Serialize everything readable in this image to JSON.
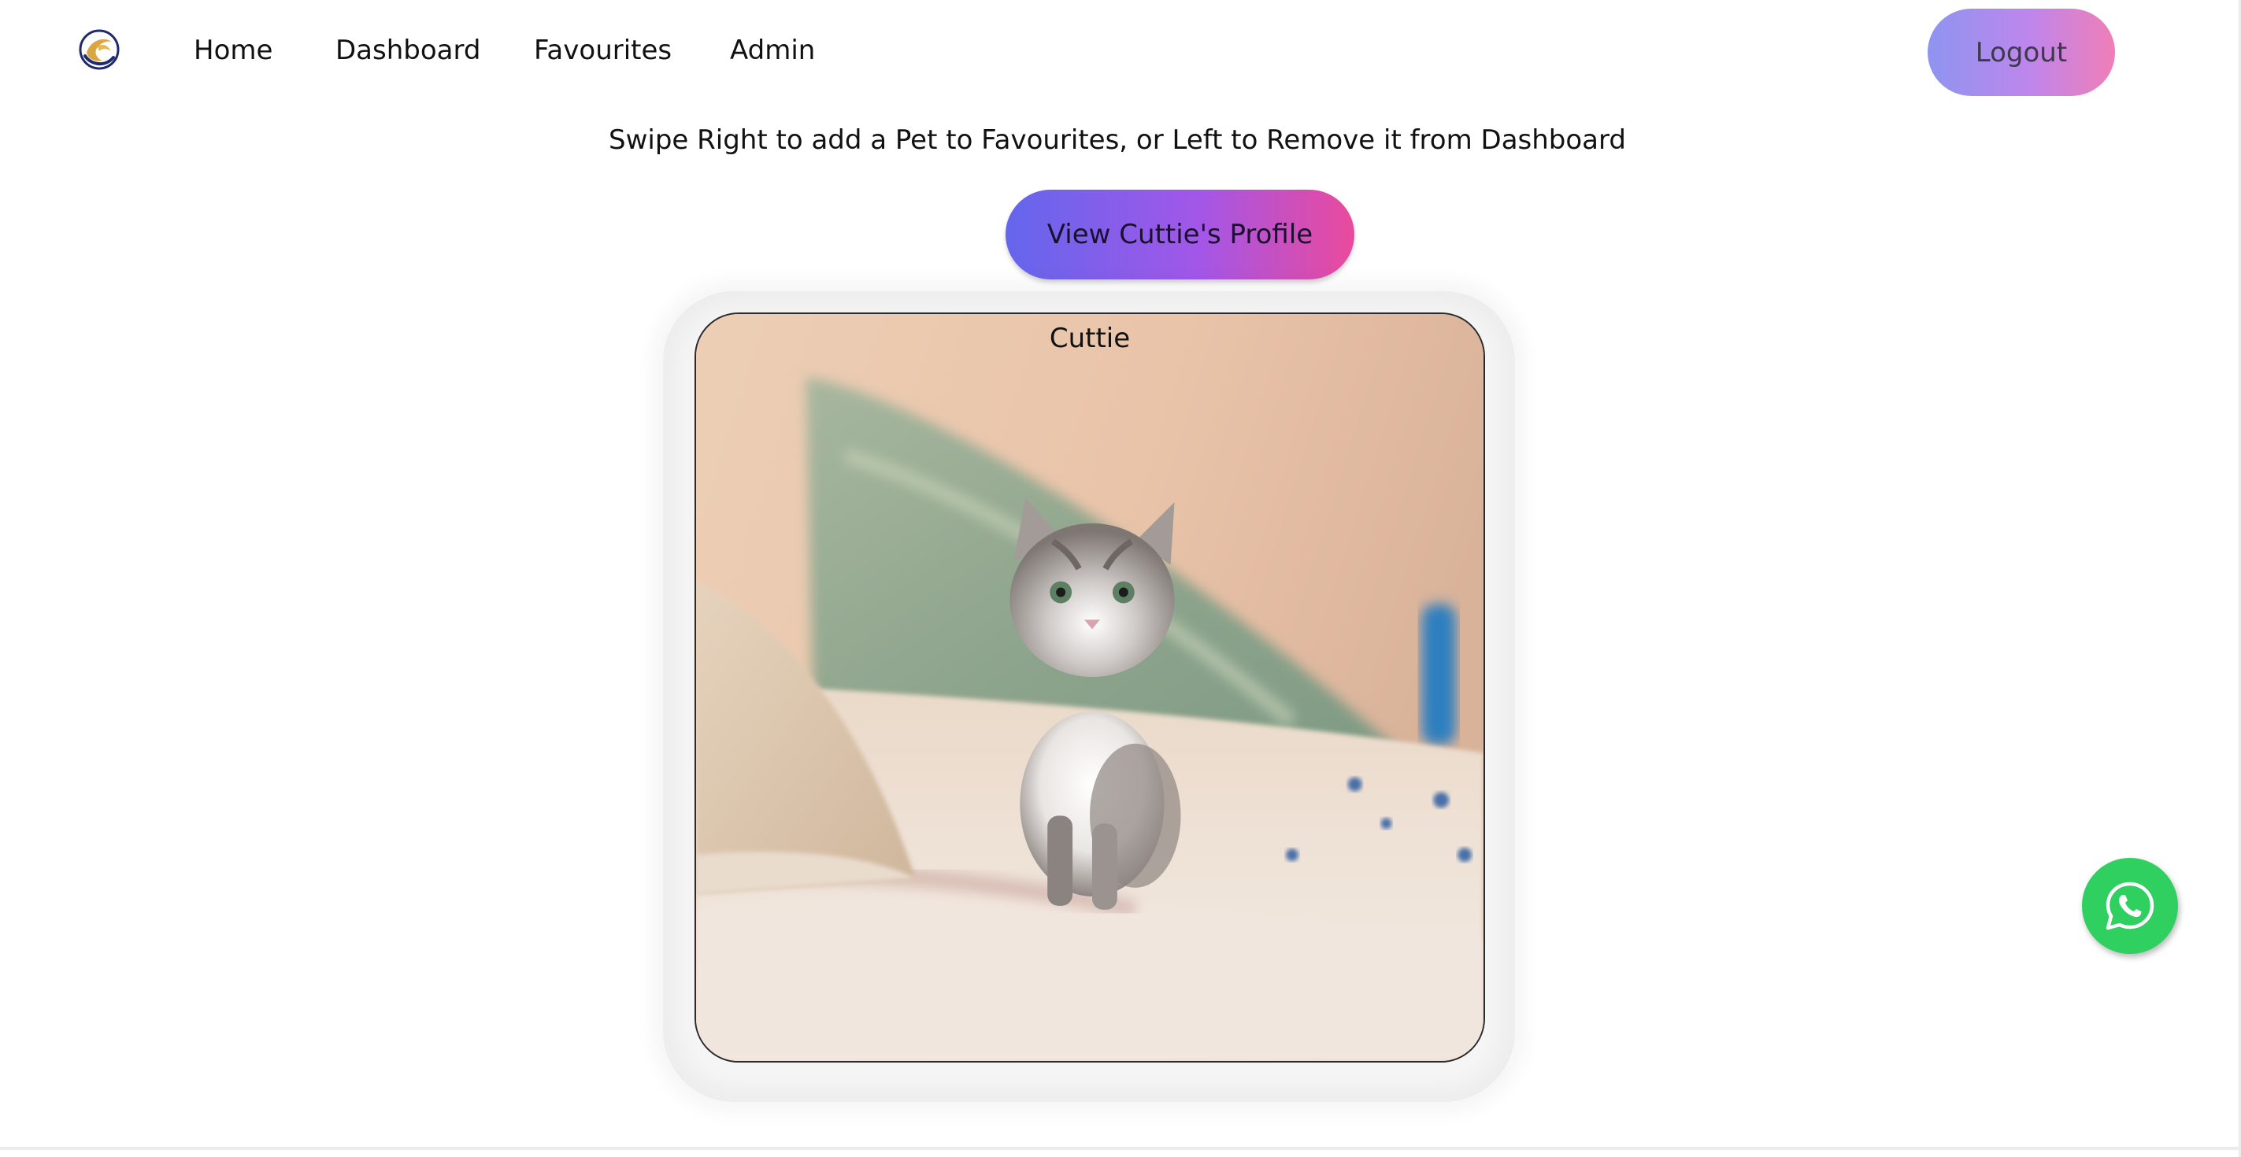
{
  "nav": {
    "logo_icon": "globe-logo-icon",
    "links": [
      {
        "label": "Home"
      },
      {
        "label": "Dashboard"
      },
      {
        "label": "Favourites"
      },
      {
        "label": "Admin"
      }
    ],
    "logout_label": "Logout"
  },
  "main": {
    "instruction": "Swipe Right to add a Pet to Favourites, or Left to Remove it from Dashboard",
    "profile_button_label": "View Cuttie's Profile",
    "pet": {
      "name": "Cuttie",
      "photo_alt": "Cuttie"
    }
  },
  "floating": {
    "whatsapp_icon": "whatsapp-icon"
  },
  "colors": {
    "logout_gradient": [
      "#8e94f0",
      "#bf86ec",
      "#f07eb6"
    ],
    "profile_gradient": [
      "#6466ec",
      "#a257e8",
      "#ea4a9c"
    ],
    "whatsapp_green": "#2fcf60"
  }
}
